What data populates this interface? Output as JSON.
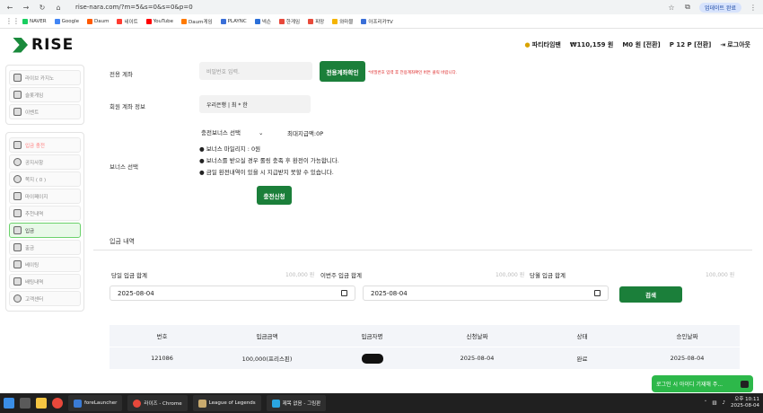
{
  "browser": {
    "url": "rise-nara.com/?m=5&s=0&s=0&p=0",
    "profile_label": "업데이트 완료",
    "bookmarks": [
      {
        "label": "NAVER",
        "color": "#19ce60"
      },
      {
        "label": "Google",
        "color": "#4285f4"
      },
      {
        "label": "Daum",
        "color": "#ff5a00"
      },
      {
        "label": "네이트",
        "color": "#ff3b30"
      },
      {
        "label": "YouTube",
        "color": "#ff0000"
      },
      {
        "label": "Daum게임",
        "color": "#ff7a00"
      },
      {
        "label": "PLAYNC",
        "color": "#3a6fd8"
      },
      {
        "label": "넥슨",
        "color": "#2b6fd8"
      },
      {
        "label": "한게임",
        "color": "#e8483b"
      },
      {
        "label": "피망",
        "color": "#e84b3b"
      },
      {
        "label": "와마블",
        "color": "#f5b400"
      },
      {
        "label": "아프리카TV",
        "color": "#3a6fd8"
      }
    ]
  },
  "header": {
    "brand": "RISE",
    "username": "파티타임팬",
    "balance": "₩110,159 원",
    "m_balance": "M0 원 [전환]",
    "points": "P 12 P [전환]",
    "logout": "로그아웃"
  },
  "sidebar": {
    "group1": [
      "라이브 카지노",
      "슬롯게임",
      "이벤트"
    ],
    "group2": [
      "입금 충전",
      "공지사항",
      "쪽지 ( 0 )",
      "마이페이지",
      "추천내역",
      "입금",
      "출금",
      "베이팅",
      "배팅내역",
      "고객센터"
    ]
  },
  "form": {
    "account_label": "전용 계좌",
    "password_placeholder": "비밀번호 입력.",
    "check_button": "전용계좌확인",
    "warning": "*비밀번호 입력 후 전용계좌확인 버튼 클릭 바랍니다.",
    "member_account_label": "회원 계좌 정보",
    "member_account_value": "우리은행 | 최 * 한",
    "bonus_label": "보너스 선택",
    "bonus_select": "충전보너스 선택",
    "max_amount": "최대지급액:0P",
    "bullets": [
      "● 보너스 마일리지 : 0원",
      "● 보너스를 받으실 경우 롤링 충족 후 환전이 가능합니다.",
      "● 금일 환전내역이 있을 시 지급받지 못할 수 있습니다."
    ],
    "apply_button": "충전신청"
  },
  "history": {
    "title": "입금 내역",
    "summaries": [
      {
        "label": "당일 입금 합계",
        "value": "100,000 원"
      },
      {
        "label": "이번주 입금 합계",
        "value": "100,000 원"
      },
      {
        "label": "당월 입금 합계",
        "value": "100,000 원"
      }
    ],
    "date_from": "2025-08-04",
    "date_to": "2025-08-04",
    "search_button": "검색",
    "columns": [
      "번호",
      "입금금액",
      "입금자명",
      "신청날짜",
      "상태",
      "승인날짜"
    ],
    "rows": [
      {
        "no": "121086",
        "amount": "100,000(프리스핀)",
        "name": "",
        "req_date": "2025-08-04",
        "status": "완료",
        "approve_date": "2025-08-04"
      }
    ]
  },
  "toast": {
    "text": "로그인 시 아이디 기재해 주..."
  },
  "taskbar": {
    "apps": [
      {
        "label": "foreLauncher",
        "color": "#3a7bd5"
      },
      {
        "label": "라이즈 - Chrome",
        "color": "#e8483b"
      },
      {
        "label": "League of Legends",
        "color": "#c8aa6e"
      },
      {
        "label": "제목 없음 - 그림판",
        "color": "#2aa5e0"
      }
    ],
    "time": "오후 10:11",
    "date": "2025-08-04"
  }
}
